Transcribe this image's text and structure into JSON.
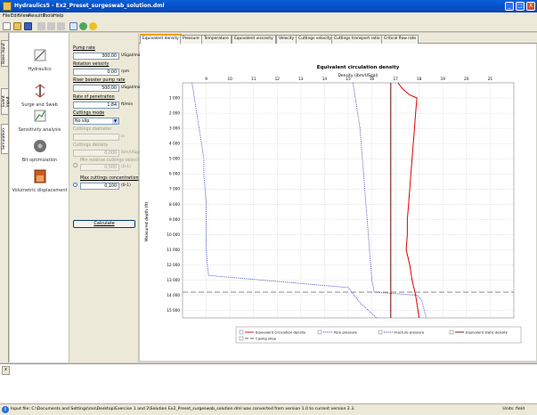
{
  "window": {
    "title": "Hydraulics5 - Ex2_Preset_surgeswab_solution.dml",
    "minimize": "_",
    "maximize": "□",
    "close": "X"
  },
  "menu": [
    "File",
    "Edit",
    "View",
    "Results",
    "Tools",
    "Help"
  ],
  "side_tabs": [
    "Base input",
    "Event input",
    "Simulation"
  ],
  "tools": [
    "Hydraulics",
    "Surge and Swab",
    "Sensitivity analysis",
    "Bit optimization",
    "Volumetric displacement"
  ],
  "params": {
    "pump_rate": {
      "label": "Pump rate",
      "value": "300,00",
      "unit": "USgal/min"
    },
    "rotation_velocity": {
      "label": "Rotation velocity",
      "value": "0,00",
      "unit": "rpm"
    },
    "riser_booster": {
      "label": "Riser booster pump rate",
      "value": "500,00",
      "unit": "USgal/min"
    },
    "rop": {
      "label": "Rate of penetration",
      "value": "1,84",
      "unit": "ft/min"
    },
    "cuttings_mode": {
      "label": "Cuttings mode",
      "value": "No slip"
    },
    "cuttings_diameter": {
      "label": "Cuttings diameter",
      "value": "",
      "unit": "in"
    },
    "cuttings_density": {
      "label": "Cuttings density",
      "value": "0,000",
      "unit": "lbm/USgal"
    },
    "min_rel_velocity": {
      "label": "Min relative cuttings velocity",
      "value": "0,500",
      "unit": "(0-1)"
    },
    "max_concentration": {
      "label": "Max cuttings concentration",
      "value": "0,100",
      "unit": "(0-1)"
    },
    "calculate": "Calculate"
  },
  "tabs": [
    "Equivalent density",
    "Pressure",
    "Temperature",
    "Equivalent viscosity",
    "Velocity",
    "Cuttings velocity",
    "Cuttings transport ratio",
    "Critical flow rate"
  ],
  "chart_data": {
    "type": "line",
    "title": "Equivalent circulation density",
    "xlabel": "Density (lbm/USgal)",
    "ylabel": "Measured depth (ft)",
    "xlim": [
      8,
      22
    ],
    "ylim": [
      0,
      15500
    ],
    "xticks": [
      9,
      10,
      11,
      12,
      13,
      14,
      15,
      16,
      17,
      18,
      19,
      20,
      21
    ],
    "yticks": [
      1000,
      2000,
      3000,
      4000,
      5000,
      6000,
      7000,
      8000,
      9000,
      10000,
      11000,
      12000,
      13000,
      14000,
      15000
    ],
    "ytick_labels": [
      "1 000",
      "2 000",
      "3 000",
      "4 000",
      "5 000",
      "6 000",
      "7 000",
      "8 000",
      "9 000",
      "10 000",
      "11 000",
      "12 000",
      "13 000",
      "14 000",
      "15 000"
    ],
    "casing_shoe_depth": 13800,
    "series": [
      {
        "name": "Equivalent circulation density",
        "color": "#e00000",
        "style": "solid",
        "x": [
          17.1,
          17.3,
          17.6,
          17.9,
          17.85,
          17.8,
          17.75,
          17.7,
          17.65,
          17.6,
          17.55,
          17.5,
          17.5,
          17.45,
          17.6,
          17.7,
          17.85,
          18.0
        ],
        "y": [
          0,
          400,
          800,
          1000,
          2000,
          3000,
          4000,
          5000,
          6000,
          7000,
          8000,
          9000,
          10000,
          11000,
          12000,
          13000,
          14000,
          15500
        ]
      },
      {
        "name": "Pore pressure",
        "color": "#1a2ab0",
        "style": "dotted",
        "x": [
          8.4,
          8.5,
          8.6,
          8.7,
          8.8,
          8.9,
          8.9,
          8.95,
          9.0,
          9.0,
          9.0,
          9.0,
          9.05,
          9.1,
          15.0,
          15.5,
          16.2
        ],
        "y": [
          0,
          1000,
          2000,
          3000,
          4000,
          5000,
          6000,
          7000,
          8000,
          9000,
          10000,
          11000,
          12000,
          12700,
          13500,
          14500,
          15500
        ]
      },
      {
        "name": "Fracture pressure",
        "color": "#1a2ab0",
        "style": "dotted",
        "x": [
          15.2,
          15.3,
          15.4,
          15.5,
          15.55,
          15.6,
          15.65,
          15.7,
          15.75,
          15.8,
          15.85,
          15.9,
          15.95,
          16.0,
          16.1,
          17.9,
          18.1,
          18.3
        ],
        "y": [
          0,
          1000,
          2000,
          3000,
          4000,
          5000,
          6000,
          7000,
          8000,
          9000,
          10000,
          11000,
          12000,
          13000,
          13800,
          14000,
          14300,
          15500
        ]
      },
      {
        "name": "Equivalent static density",
        "color": "#700000",
        "style": "solid",
        "x": [
          16.8,
          16.8
        ],
        "y": [
          0,
          15500
        ]
      },
      {
        "name": "Casing shoe",
        "color": "#666666",
        "style": "dashed",
        "x": [],
        "y": []
      }
    ],
    "legend": [
      "Equivalent circulation density",
      "Pore pressure",
      "Fracture pressure",
      "Equivalent static density",
      "Casing shoe"
    ]
  },
  "console_close": "x",
  "status": {
    "message": "Input file: C:\\Documents and Settings\\mo\\Desktop\\Exercise 1 and 2\\Solution Ex2_Preset_surgeswab_solution.dml was converted from version 1.0 to current version 2.3.",
    "units": "Units: field",
    "info": "i"
  }
}
